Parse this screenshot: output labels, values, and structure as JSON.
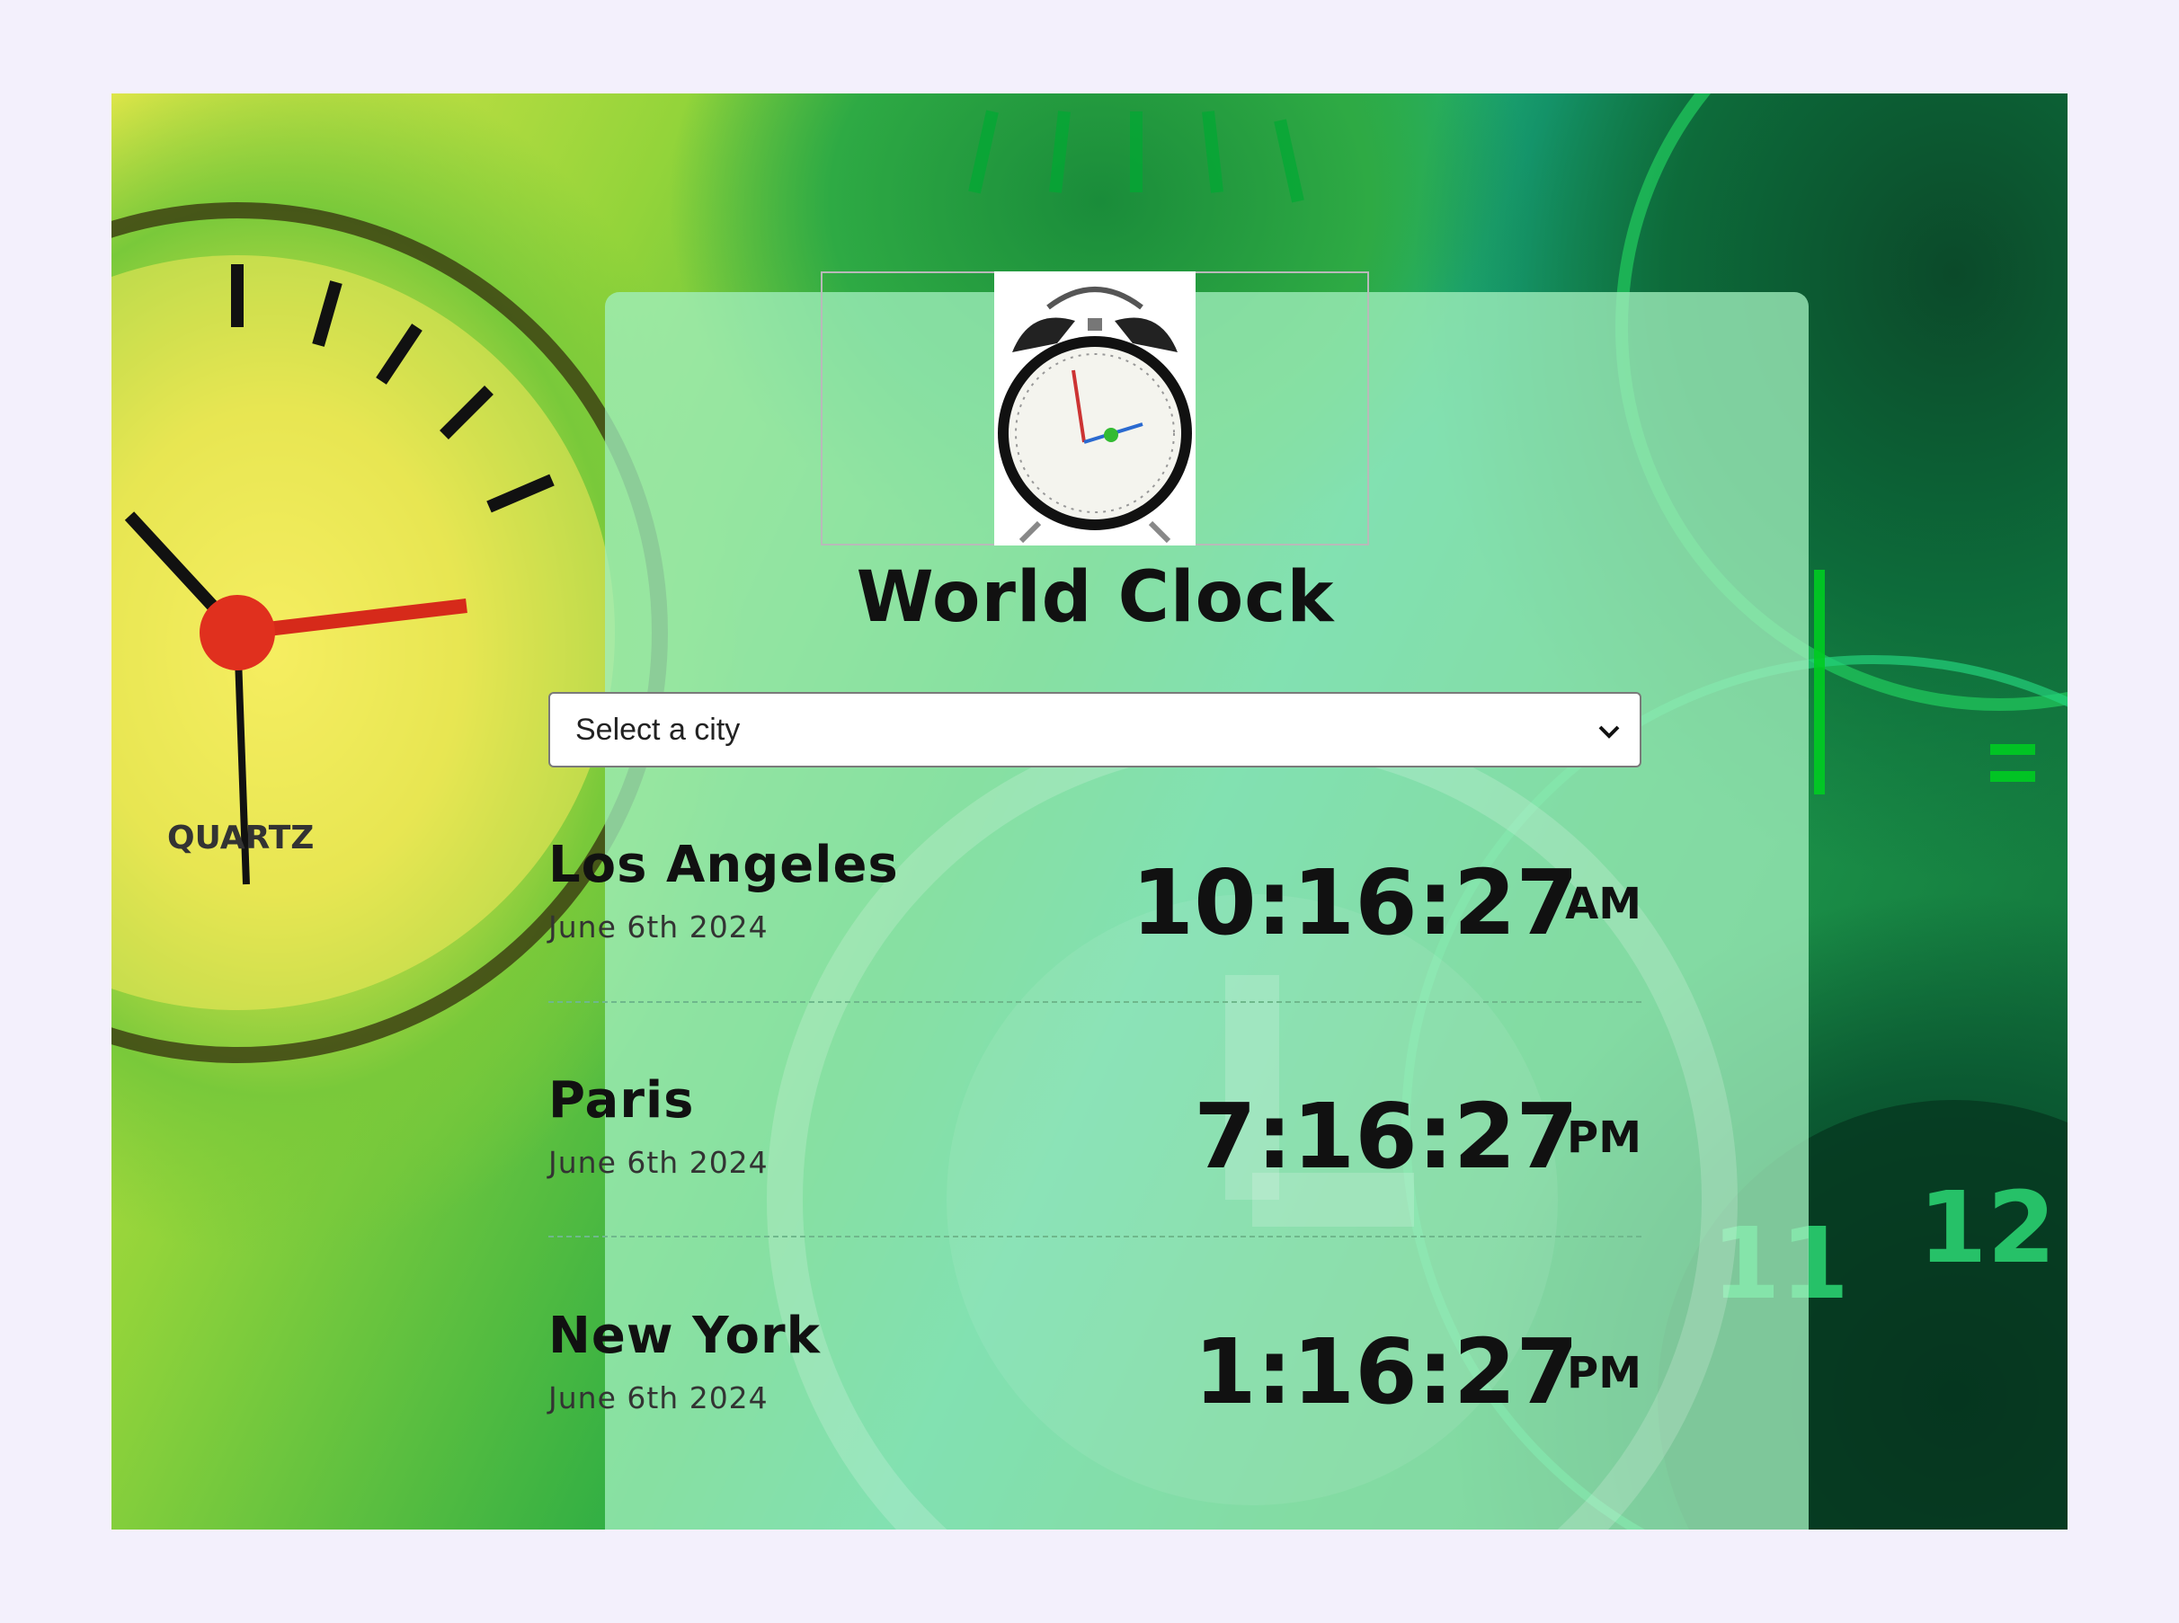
{
  "app": {
    "title": "World Clock",
    "logo_icon": "alarm-clock-icon"
  },
  "select": {
    "placeholder": "Select a city",
    "icon": "chevron-down-icon"
  },
  "clocks": [
    {
      "city": "Los Angeles",
      "date": "June 6th 2024",
      "time": "10:16:27",
      "ampm": "AM"
    },
    {
      "city": "Paris",
      "date": "June 6th 2024",
      "time": "7:16:27",
      "ampm": "PM"
    },
    {
      "city": "New York",
      "date": "June 6th 2024",
      "time": "1:16:27",
      "ampm": "PM"
    }
  ],
  "background": {
    "description_colors": {
      "accent": "#2fae44",
      "card": "#a0eebc"
    },
    "watch_text": "QUARTZ"
  }
}
